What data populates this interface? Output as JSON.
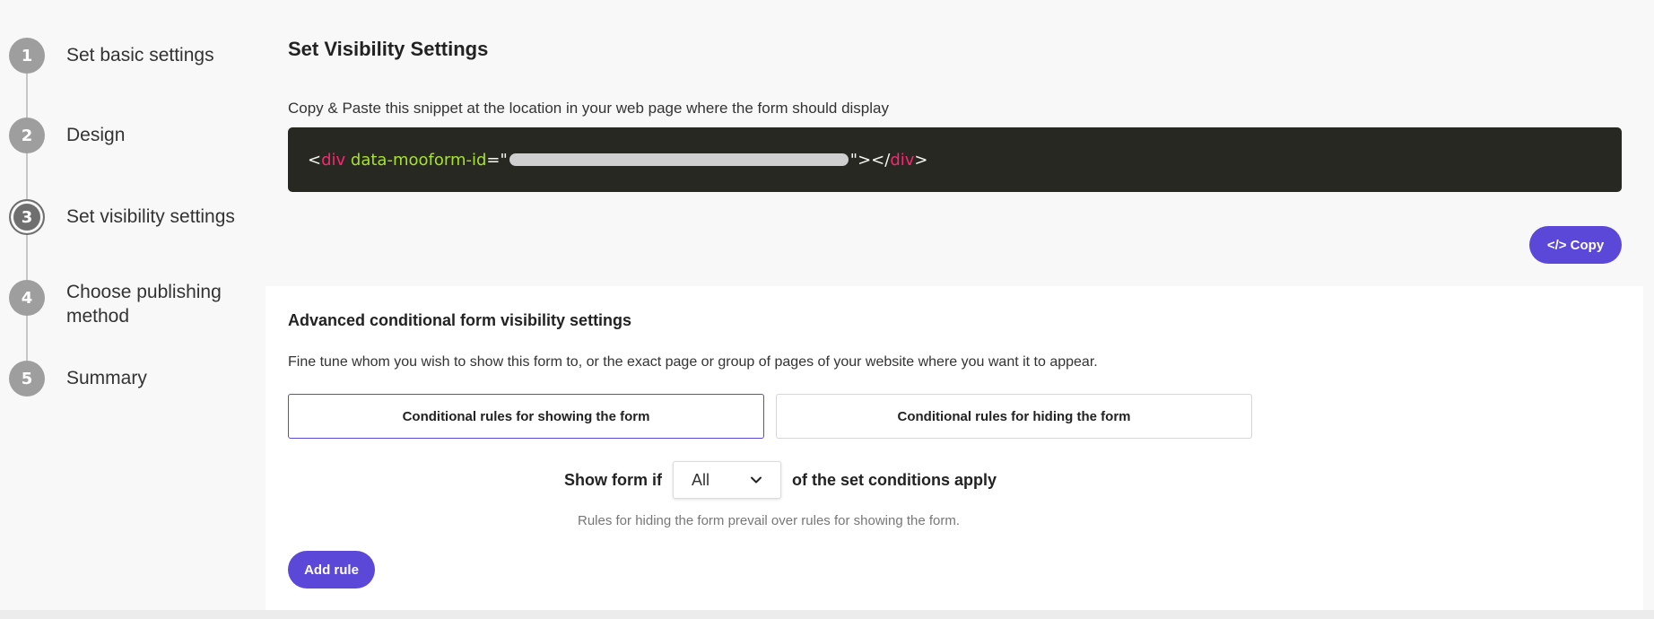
{
  "stepper": {
    "steps": [
      {
        "number": "1",
        "label": "Set basic settings"
      },
      {
        "number": "2",
        "label": "Design"
      },
      {
        "number": "3",
        "label": "Set visibility settings"
      },
      {
        "number": "4",
        "label": "Choose publishing method"
      },
      {
        "number": "5",
        "label": "Summary"
      }
    ],
    "active_step": "3"
  },
  "header": {
    "title": "Set Visibility Settings",
    "snippet_hint": "Copy & Paste this snippet at the location in your web page where the form should display"
  },
  "snippet": {
    "open_lt": "<",
    "tag": "div",
    "attr": "data-mooform-id",
    "eq_quote": "=\"",
    "close_quote": "\"",
    "gt_lt_slash": " ></",
    "tag_close": "div",
    "gt": ">"
  },
  "copy_button": {
    "label": "</> Copy"
  },
  "advanced": {
    "title": "Advanced conditional form visibility settings",
    "description": "Fine tune whom you wish to show this form to, or the exact page or group of pages of your website where you want it to appear.",
    "tabs": [
      {
        "label": "Conditional rules for showing the form"
      },
      {
        "label": "Conditional rules for hiding the form"
      }
    ],
    "show_prefix": "Show form if",
    "select_value": "All",
    "show_suffix": "of the set conditions apply",
    "note": "Rules for hiding the form prevail over rules for showing the form.",
    "add_rule_label": "Add rule"
  },
  "colors": {
    "accent": "#5b48d9",
    "code_bg": "#272822",
    "code_tag": "#f92672",
    "code_attr": "#a6e22e",
    "step_circle": "#9e9e9e"
  },
  "icons": {
    "select": "chevron-down-icon"
  }
}
